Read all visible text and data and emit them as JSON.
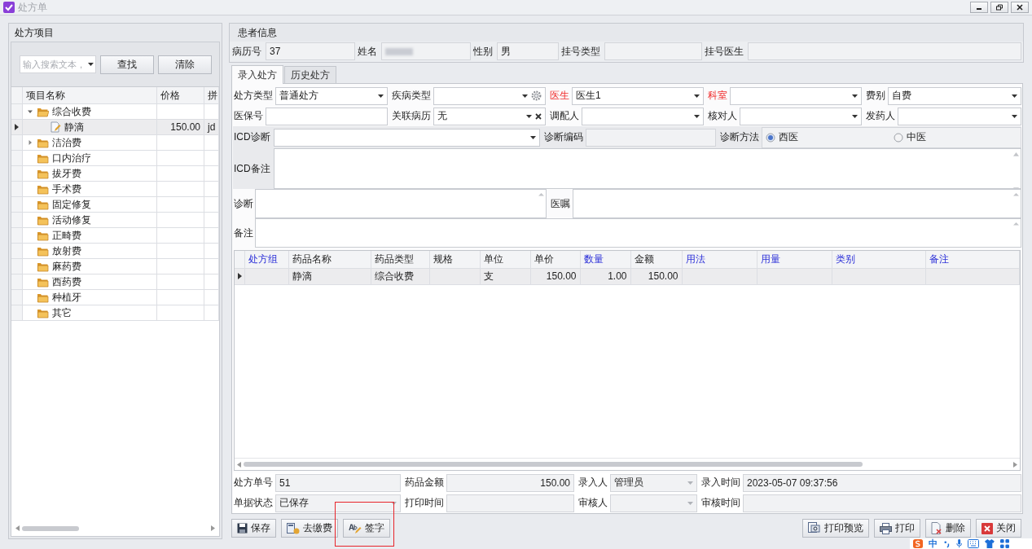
{
  "window": {
    "title": "处方单"
  },
  "item_panel": {
    "title": "处方项目",
    "search": {
      "placeholder": "输入搜索文本，"
    },
    "buttons": [
      "查找",
      "清除"
    ],
    "columns": [
      "项目名称",
      "价格",
      "拼"
    ],
    "rows": [
      {
        "name": "综合收费",
        "kind": "group",
        "expanded": true,
        "selected": false,
        "children": [
          {
            "name": "静滴",
            "kind": "item",
            "price": "150.00",
            "pinyin": "jd",
            "selected": true
          }
        ]
      },
      {
        "name": "洁治费",
        "kind": "group",
        "expanded": false,
        "selected": false
      },
      {
        "name": "口内治疗",
        "kind": "folder",
        "selected": false
      },
      {
        "name": "拔牙费",
        "kind": "folder",
        "selected": false
      },
      {
        "name": "手术费",
        "kind": "folder",
        "selected": false
      },
      {
        "name": "固定修复",
        "kind": "folder",
        "selected": false
      },
      {
        "name": "活动修复",
        "kind": "folder",
        "selected": false
      },
      {
        "name": "正畸费",
        "kind": "folder",
        "selected": false
      },
      {
        "name": "放射费",
        "kind": "folder",
        "selected": false
      },
      {
        "name": "麻药费",
        "kind": "folder",
        "selected": false
      },
      {
        "name": "西药费",
        "kind": "folder",
        "selected": false
      },
      {
        "name": "种植牙",
        "kind": "folder",
        "selected": false
      },
      {
        "name": "其它",
        "kind": "folder",
        "selected": false
      }
    ]
  },
  "patient": {
    "title": "患者信息",
    "fields": [
      {
        "label": "病历号",
        "kind": "readonly-text",
        "value": "37"
      },
      {
        "label": "姓名",
        "kind": "redacted"
      },
      {
        "label": "性别",
        "kind": "readonly-text",
        "value": "男"
      },
      {
        "label": "挂号类型",
        "kind": "readonly-text"
      },
      {
        "label": "挂号医生",
        "kind": "readonly-text"
      }
    ]
  },
  "tabs": [
    {
      "label": "录入处方",
      "selected": true
    },
    {
      "label": "历史处方",
      "selected": false
    }
  ],
  "form_rows": [
    [
      {
        "label": "处方类型",
        "kind": "dropdown",
        "value": "普通处方",
        "required": false
      },
      {
        "label": "疾病类型",
        "kind": "dropdown-gear",
        "required": false
      },
      {
        "label": "医生",
        "kind": "dropdown",
        "value": "医生1",
        "required": true
      },
      {
        "label": "科室",
        "kind": "dropdown",
        "required": true
      },
      {
        "label": "费别",
        "kind": "dropdown",
        "value": "自费",
        "required": false
      }
    ],
    [
      {
        "label": "医保号",
        "kind": "text",
        "required": false
      },
      {
        "label": "关联病历",
        "kind": "dropdown-clear",
        "value": "无",
        "required": false
      },
      {
        "label": "调配人",
        "kind": "dropdown",
        "required": false
      },
      {
        "label": "核对人",
        "kind": "dropdown",
        "required": false
      },
      {
        "label": "发药人",
        "kind": "dropdown",
        "required": false
      }
    ],
    [
      {
        "label": "ICD诊断",
        "kind": "dropdown"
      },
      {
        "label": "诊断编码",
        "kind": "readonly-text"
      },
      {
        "label": "诊断方法",
        "kind": "radio",
        "options": [
          {
            "label": "西医",
            "selected": true
          },
          {
            "label": "中医",
            "selected": false
          }
        ]
      }
    ],
    [
      {
        "label": "ICD备注",
        "kind": "memo"
      }
    ],
    [
      {
        "label": "诊断",
        "kind": "memo"
      },
      {
        "label": "医嘱",
        "kind": "memo"
      }
    ],
    [
      {
        "label": "备注",
        "kind": "memo"
      }
    ]
  ],
  "drug_grid": {
    "columns": [
      {
        "label": "处方组",
        "editable": true
      },
      {
        "label": "药品名称",
        "editable": false
      },
      {
        "label": "药品类型",
        "editable": false
      },
      {
        "label": "规格",
        "editable": false
      },
      {
        "label": "单位",
        "editable": false
      },
      {
        "label": "单价",
        "editable": false
      },
      {
        "label": "数量",
        "editable": true
      },
      {
        "label": "金额",
        "editable": false
      },
      {
        "label": "用法",
        "editable": true
      },
      {
        "label": "用量",
        "editable": true
      },
      {
        "label": "类别",
        "editable": true
      },
      {
        "label": "备注",
        "editable": true
      }
    ],
    "rows": [
      {
        "selected": true,
        "cells": [
          null,
          "静滴",
          "综合收费",
          null,
          "支",
          "150.00",
          "1.00",
          "150.00",
          null,
          null,
          null,
          null
        ]
      }
    ]
  },
  "footer_rows": [
    [
      {
        "label": "处方单号",
        "kind": "readonly-text",
        "value": "51"
      },
      {
        "label": "药品金额",
        "kind": "readonly-amount",
        "value": "150.00"
      },
      {
        "label": "录入人",
        "kind": "readonly-dropdown",
        "value": "管理员"
      },
      {
        "label": "录入时间",
        "kind": "readonly-text",
        "value": "2023-05-07 09:37:56"
      }
    ],
    [
      {
        "label": "单据状态",
        "kind": "readonly-dropdown",
        "value": "已保存"
      },
      {
        "label": "打印时间",
        "kind": "readonly-text"
      },
      {
        "label": "审核人",
        "kind": "readonly-dropdown"
      },
      {
        "label": "审核时间",
        "kind": "readonly-text"
      }
    ]
  ],
  "toolbar": {
    "left": [
      {
        "label": "保存",
        "kind": "save",
        "highlighted": false
      },
      {
        "label": "去缴费",
        "kind": "pay",
        "highlighted": false
      },
      {
        "label": "签字",
        "kind": "sign",
        "highlighted": true
      }
    ],
    "right": [
      {
        "label": "打印预览",
        "kind": "preview",
        "highlighted": false
      },
      {
        "label": "打印",
        "kind": "print",
        "highlighted": false
      },
      {
        "label": "删除",
        "kind": "delete",
        "highlighted": false
      },
      {
        "label": "关闭",
        "kind": "close",
        "highlighted": false
      }
    ]
  },
  "ime_toolbar": {
    "mode": "中"
  }
}
